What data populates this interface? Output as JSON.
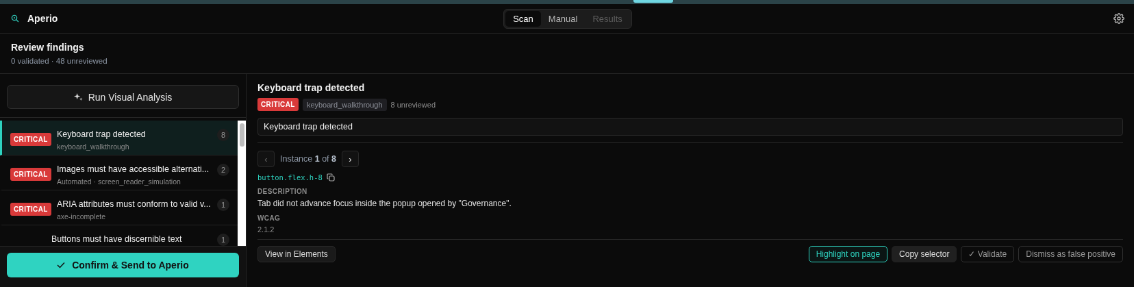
{
  "app": {
    "title": "Aperio"
  },
  "tabs": [
    {
      "label": "Scan",
      "selected": true,
      "disabled": false
    },
    {
      "label": "Manual",
      "selected": false,
      "disabled": false
    },
    {
      "label": "Results",
      "selected": false,
      "disabled": true
    }
  ],
  "review": {
    "title": "Review findings",
    "summary": "0 validated · 48 unreviewed"
  },
  "run_button": "Run Visual Analysis",
  "findings": [
    {
      "severity": "CRITICAL",
      "title": "Keyboard trap detected",
      "source": "keyboard_walkthrough",
      "count": "8",
      "selected": true
    },
    {
      "severity": "CRITICAL",
      "title": "Images must have accessible alternati...",
      "source": "Automated · screen_reader_simulation",
      "count": "2",
      "selected": false
    },
    {
      "severity": "CRITICAL",
      "title": "ARIA attributes must conform to valid v...",
      "source": "axe-incomplete",
      "count": "1",
      "selected": false
    },
    {
      "title": "Buttons must have discernible text",
      "count": "1",
      "selected": false
    }
  ],
  "confirm_button": "Confirm & Send to Aperio",
  "detail": {
    "title": "Keyboard trap detected",
    "severity": "CRITICAL",
    "source": "keyboard_walkthrough",
    "unreviewed": "8 unreviewed",
    "title_field": "Keyboard trap detected",
    "instance": {
      "prev": "‹",
      "next": "›",
      "text": "Instance **1** of **8**"
    },
    "selector": "button.flex.h-8",
    "description_label": "DESCRIPTION",
    "description": "Tab did not advance focus inside the popup opened by \"Governance\".",
    "wcag_label": "WCAG",
    "wcag": "2.1.2",
    "actions_left": [
      "View in Elements"
    ],
    "actions_right": [
      {
        "label": "Highlight on page",
        "kind": "accent"
      },
      {
        "label": "Copy selector",
        "kind": "filled"
      },
      {
        "label": "✓ Validate",
        "kind": "outline"
      },
      {
        "label": "Dismiss as false positive",
        "kind": "outline"
      }
    ]
  }
}
